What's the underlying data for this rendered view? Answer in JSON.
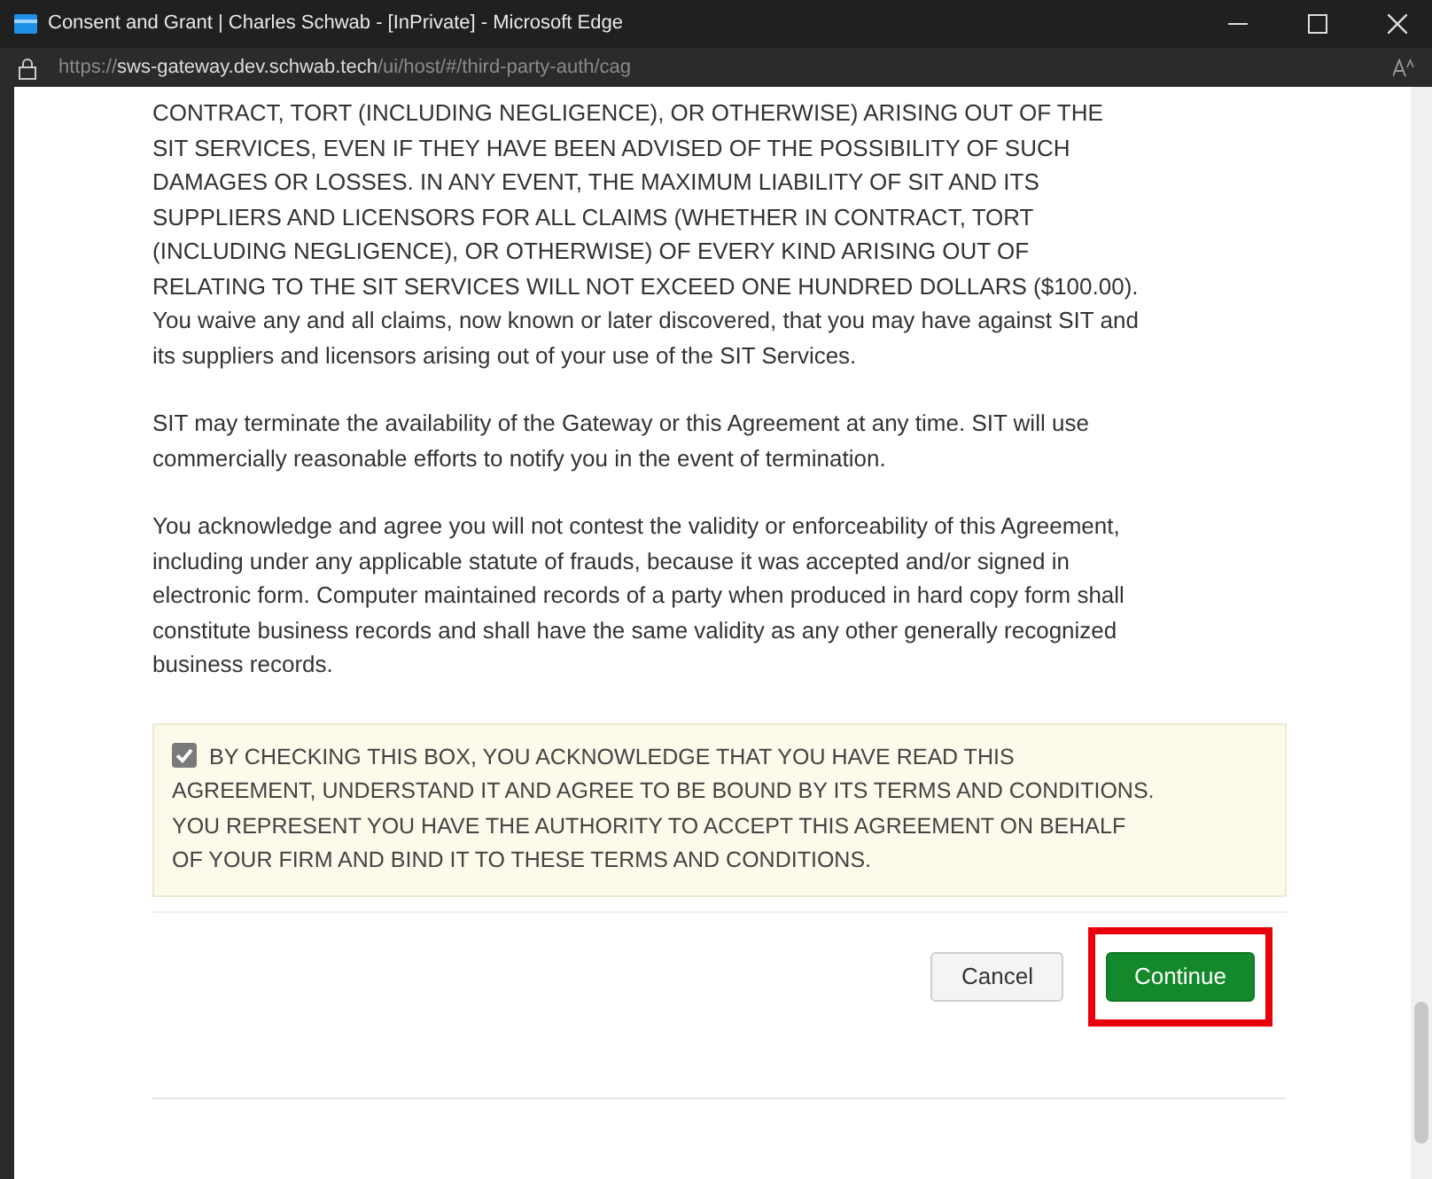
{
  "window": {
    "title": "Consent and Grant | Charles Schwab - [InPrivate] - Microsoft Edge",
    "url": "https://**sws-gateway.dev.schwab.tech**/ui/host/#/third-party-auth/cag"
  },
  "paragraphs": [
    {
      "lines": [
        "CONTRACT, TORT (INCLUDING NEGLIGENCE), OR OTHERWISE) ARISING OUT OF THE",
        "SIT SERVICES, EVEN IF THEY HAVE BEEN ADVISED OF THE POSSIBILITY OF SUCH",
        "DAMAGES OR LOSSES. IN ANY EVENT, THE MAXIMUM LIABILITY OF SIT AND ITS",
        "SUPPLIERS AND LICENSORS FOR ALL CLAIMS (WHETHER IN CONTRACT, TORT",
        "(INCLUDING NEGLIGENCE), OR OTHERWISE) OF EVERY KIND ARISING OUT OF",
        "RELATING TO THE SIT SERVICES WILL NOT EXCEED ONE HUNDRED DOLLARS ($100.00).",
        "You waive any and all claims, now known or later discovered, that you may have against SIT and",
        "its suppliers and licensors arising out of your use of the SIT Services."
      ]
    },
    {
      "lines": [
        "SIT may terminate the availability of the Gateway or this Agreement at any time. SIT will use",
        "commercially reasonable efforts to notify you in the event of termination."
      ]
    },
    {
      "lines": [
        "You acknowledge and agree you will not contest the validity or enforceability of this Agreement,",
        "including under any applicable statute of frauds, because it was accepted and/or signed in",
        "electronic form. Computer maintained records of a party when produced in hard copy form shall",
        "constitute business records and shall have the same validity as any other generally recognized",
        "business records."
      ]
    }
  ],
  "consent": {
    "checked": true,
    "lines": [
      "BY CHECKING THIS BOX, YOU ACKNOWLEDGE THAT YOU HAVE READ THIS",
      "AGREEMENT, UNDERSTAND IT AND AGREE TO BE BOUND BY ITS TERMS AND CONDITIONS.",
      "YOU REPRESENT YOU HAVE THE AUTHORITY TO ACCEPT THIS AGREEMENT ON BEHALF",
      "OF YOUR FIRM AND BIND IT TO THESE TERMS AND CONDITIONS."
    ]
  },
  "buttons": [
    {
      "label": "Cancel",
      "kind": "secondary"
    },
    {
      "label": "Continue",
      "kind": "primary"
    }
  ]
}
